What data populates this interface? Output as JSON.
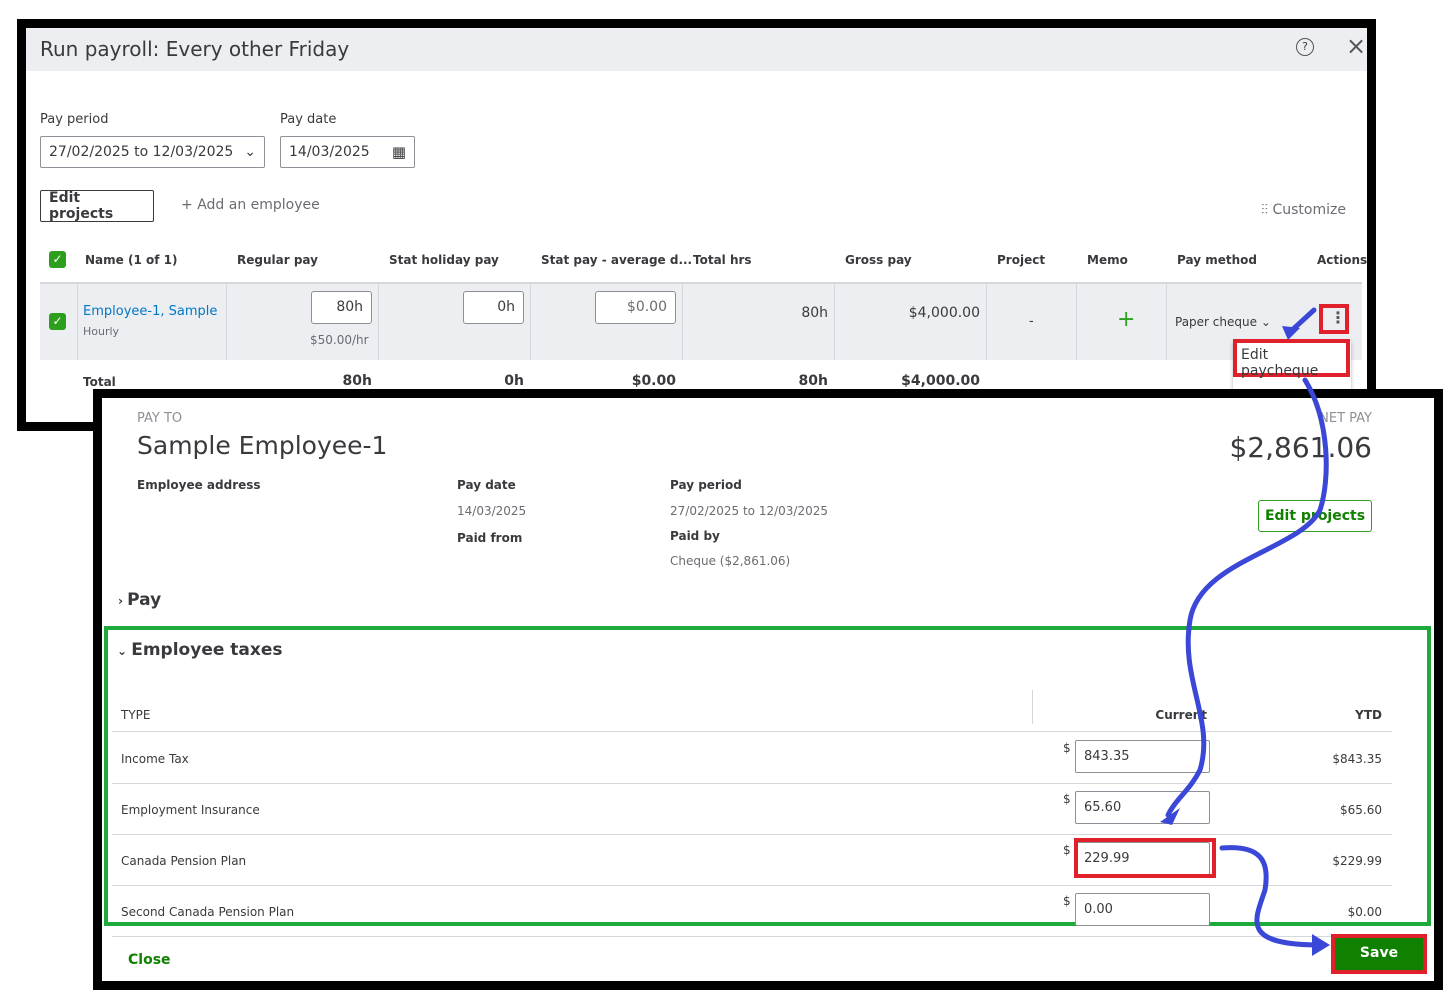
{
  "run_payroll": {
    "title": "Run payroll: Every other Friday",
    "pay_period_label": "Pay period",
    "pay_period_value": "27/02/2025 to 12/03/2025",
    "pay_date_label": "Pay date",
    "pay_date_value": "14/03/2025",
    "edit_projects": "Edit projects",
    "add_employee": "Add an employee",
    "customize": "Customize",
    "columns": [
      "Name (1 of 1)",
      "Regular pay",
      "Stat holiday pay",
      "Stat pay - average d...",
      "Total hrs",
      "Gross pay",
      "Project",
      "Memo",
      "Pay method",
      "Actions"
    ],
    "employee": {
      "name": "Employee-1, Sample",
      "type": "Hourly",
      "regular_hours": "80h",
      "rate": "$50.00/hr",
      "stat_holiday": "0h",
      "stat_avg": "$0.00",
      "total_hrs": "80h",
      "gross": "$4,000.00",
      "project": "-",
      "pay_method": "Paper cheque"
    },
    "total": {
      "label": "Total",
      "regular": "80h",
      "stat_holiday": "0h",
      "stat_avg": "$0.00",
      "total_hrs": "80h",
      "gross": "$4,000.00"
    },
    "menu": {
      "edit_paycheque": "Edit paycheque"
    }
  },
  "paycheque": {
    "pay_to_label": "PAY TO",
    "employee_name": "Sample Employee-1",
    "net_pay_label": "NET PAY",
    "net_pay": "$2,861.06",
    "employee_address_label": "Employee address",
    "pay_date_label": "Pay date",
    "pay_date": "14/03/2025",
    "paid_from_label": "Paid from",
    "pay_period_label": "Pay period",
    "pay_period": "27/02/2025 to 12/03/2025",
    "paid_by_label": "Paid by",
    "paid_by": "Cheque ($2,861.06)",
    "edit_projects": "Edit projects",
    "pay_section": "Pay",
    "taxes_section": "Employee taxes",
    "col_type": "TYPE",
    "col_current": "Current",
    "col_ytd": "YTD",
    "currency": "$",
    "taxes": [
      {
        "type": "Income Tax",
        "current": "843.35",
        "ytd": "$843.35"
      },
      {
        "type": "Employment Insurance",
        "current": "65.60",
        "ytd": "$65.60"
      },
      {
        "type": "Canada Pension Plan",
        "current": "229.99",
        "ytd": "$229.99"
      },
      {
        "type": "Second Canada Pension Plan",
        "current": "0.00",
        "ytd": "$0.00"
      }
    ],
    "close": "Close",
    "save": "Save"
  },
  "colors": {
    "green": "#2ca01c",
    "link": "#0077c5",
    "annotation_red": "#e0202a",
    "annotation_blue": "#3b47d6",
    "save_green": "#108000"
  }
}
